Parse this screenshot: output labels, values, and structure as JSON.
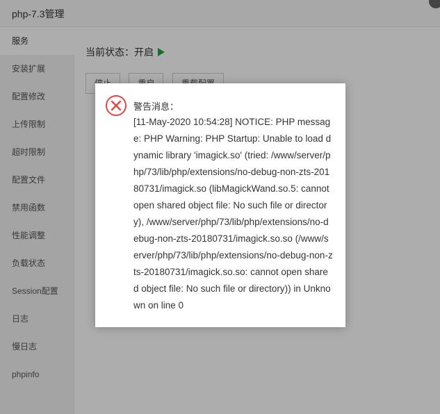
{
  "window": {
    "title": "php-7.3管理"
  },
  "sidebar": {
    "items": [
      {
        "label": "服务",
        "active": true
      },
      {
        "label": "安装扩展"
      },
      {
        "label": "配置修改"
      },
      {
        "label": "上传限制"
      },
      {
        "label": "超时限制"
      },
      {
        "label": "配置文件"
      },
      {
        "label": "禁用函数"
      },
      {
        "label": "性能调整"
      },
      {
        "label": "负载状态"
      },
      {
        "label": "Session配置"
      },
      {
        "label": "日志"
      },
      {
        "label": "慢日志"
      },
      {
        "label": "phpinfo"
      }
    ]
  },
  "main": {
    "status_label": "当前状态：",
    "status_value": "开启",
    "buttons": {
      "stop": "停止",
      "restart": "重启",
      "reload": "重载配置"
    }
  },
  "dialog": {
    "icon": "error-circle-x-icon",
    "heading": "警告消息：",
    "message": "[11-May-2020 10:54:28] NOTICE: PHP message: PHP Warning: PHP Startup: Unable to load dynamic library 'imagick.so' (tried: /www/server/php/73/lib/php/extensions/no-debug-non-zts-20180731/imagick.so (libMagickWand.so.5: cannot open shared object file: No such file or directory), /www/server/php/73/lib/php/extensions/no-debug-non-zts-20180731/imagick.so.so (/www/server/php/73/lib/php/extensions/no-debug-non-zts-20180731/imagick.so.so: cannot open shared object file: No such file or directory)) in Unknown on line 0"
  },
  "colors": {
    "accent": "#20a53a",
    "error": "#e64545"
  }
}
